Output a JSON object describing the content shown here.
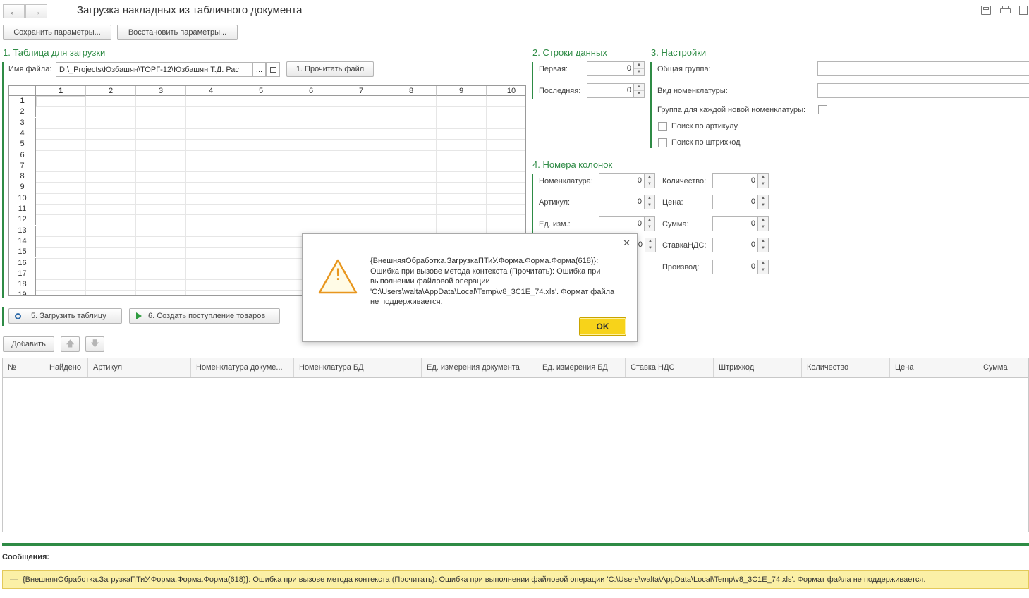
{
  "window": {
    "title": "Загрузка накладных из табличного документа",
    "nav_back": "←",
    "nav_forward": "→"
  },
  "toolbar": {
    "save_params": "Сохранить параметры...",
    "restore_params": "Восстановить параметры..."
  },
  "section1": {
    "title": "1. Таблица для загрузки",
    "file_label": "Имя файла:",
    "file_value": "D:\\_Projects\\Юзбашян\\ТОРГ-12\\Юзбашян Т.Д. Рас",
    "browse": "...",
    "read_button": "1. Прочитать файл"
  },
  "sheet": {
    "columns": [
      "1",
      "2",
      "3",
      "4",
      "5",
      "6",
      "7",
      "8",
      "9",
      "10"
    ],
    "rows": [
      "1",
      "2",
      "3",
      "4",
      "5",
      "6",
      "7",
      "8",
      "9",
      "10",
      "11",
      "12",
      "13",
      "14",
      "15",
      "16",
      "17",
      "18",
      "19"
    ]
  },
  "section2": {
    "title": "2. Строки данных",
    "first_label": "Первая:",
    "first_value": "0",
    "last_label": "Последняя:",
    "last_value": "0"
  },
  "section3": {
    "title": "3. Настройки",
    "common_group_label": "Общая группа:",
    "nomenclature_type_label": "Вид номенклатуры:",
    "group_each_label": "Группа для каждой новой номенклатуры:",
    "search_article_label": "Поиск по артикулу",
    "search_barcode_label": "Поиск по штрихкод"
  },
  "section4": {
    "title": "4. Номера колонок",
    "nomenclature_label": "Номенклатура:",
    "nomenclature_value": "0",
    "article_label": "Артикул:",
    "article_value": "0",
    "unit_label": "Ед. изм.:",
    "unit_value": "0",
    "vat_hidden_value": "0",
    "quantity_label": "Количество:",
    "quantity_value": "0",
    "price_label": "Цена:",
    "price_value": "0",
    "sum_label": "Сумма:",
    "sum_value": "0",
    "vat_rate_label": "СтавкаНДС:",
    "vat_rate_value": "0",
    "producer_label": "Производ:",
    "producer_value": "0"
  },
  "actions": {
    "load_table": "5. Загрузить таблицу",
    "create_receipt": "6. Создать поступление товаров",
    "add": "Добавить"
  },
  "table": {
    "columns": [
      "№",
      "Найдено",
      "Артикул",
      "Номенклатура докуме...",
      "Номенклатура БД",
      "Ед. измерения документа",
      "Ед. измерения БД",
      "Ставка НДС",
      "Штрихкод",
      "Количество",
      "Цена",
      "Сумма"
    ]
  },
  "dialog": {
    "message": "{ВнешняяОбработка.ЗагрузкаПТиУ.Форма.Форма.Форма(618)}: Ошибка при вызове метода контекста (Прочитать): Ошибка при выполнении файловой операции 'C:\\Users\\walta\\AppData\\Local\\Temp\\v8_3C1E_74.xls'. Формат файла не поддерживается.",
    "ok": "OK",
    "close": "✕",
    "warning_icon_mark": "!"
  },
  "messages": {
    "title": "Сообщения:",
    "dash": "—",
    "text": "{ВнешняяОбработка.ЗагрузкаПТиУ.Форма.Форма.Форма(618)}: Ошибка при вызове метода контекста (Прочитать): Ошибка при выполнении файловой операции  'C:\\Users\\walta\\AppData\\Local\\Temp\\v8_3C1E_74.xls'. Формат файла не поддерживается."
  },
  "colors": {
    "accent": "#2e8b45",
    "ok_button": "#f7d31a",
    "message_bar": "#fbf0a6",
    "warning_icon": "#e8961e"
  }
}
